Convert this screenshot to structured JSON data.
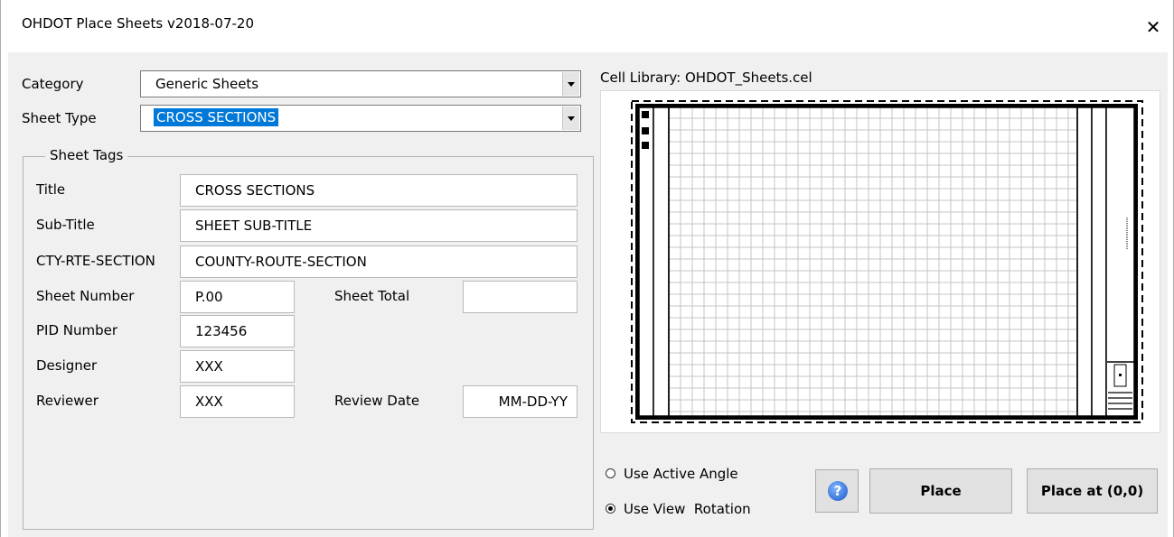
{
  "window": {
    "title": "OHDOT Place Sheets v2018-07-20",
    "close_glyph": "✕"
  },
  "category": {
    "label": "Category",
    "value": "Generic Sheets"
  },
  "sheet_type": {
    "label": "Sheet Type",
    "value": "CROSS SECTIONS"
  },
  "sheet_tags": {
    "group_title": "Sheet Tags",
    "title": {
      "label": "Title",
      "value": "CROSS SECTIONS"
    },
    "sub_title": {
      "label": "Sub-Title",
      "value": "SHEET SUB-TITLE"
    },
    "cty_rte_section": {
      "label": "CTY-RTE-SECTION",
      "value": "COUNTY-ROUTE-SECTION"
    },
    "sheet_number": {
      "label": "Sheet Number",
      "value": "P.00"
    },
    "sheet_total": {
      "label": "Sheet Total",
      "value": ""
    },
    "pid_number": {
      "label": "PID Number",
      "value": "123456"
    },
    "designer": {
      "label": "Designer",
      "value": "XXX"
    },
    "reviewer": {
      "label": "Reviewer",
      "value": "XXX"
    },
    "review_date": {
      "label": "Review Date",
      "value": "MM-DD-YY"
    }
  },
  "preview": {
    "label": "Cell Library: OHDOT_Sheets.cel"
  },
  "rotation": {
    "options": [
      {
        "label": "Use Active Angle",
        "selected": false
      },
      {
        "label": "Use View  Rotation",
        "selected": true
      }
    ]
  },
  "buttons": {
    "help_icon": "question-circle",
    "place": "Place",
    "place_at": "Place at (0,0)"
  }
}
